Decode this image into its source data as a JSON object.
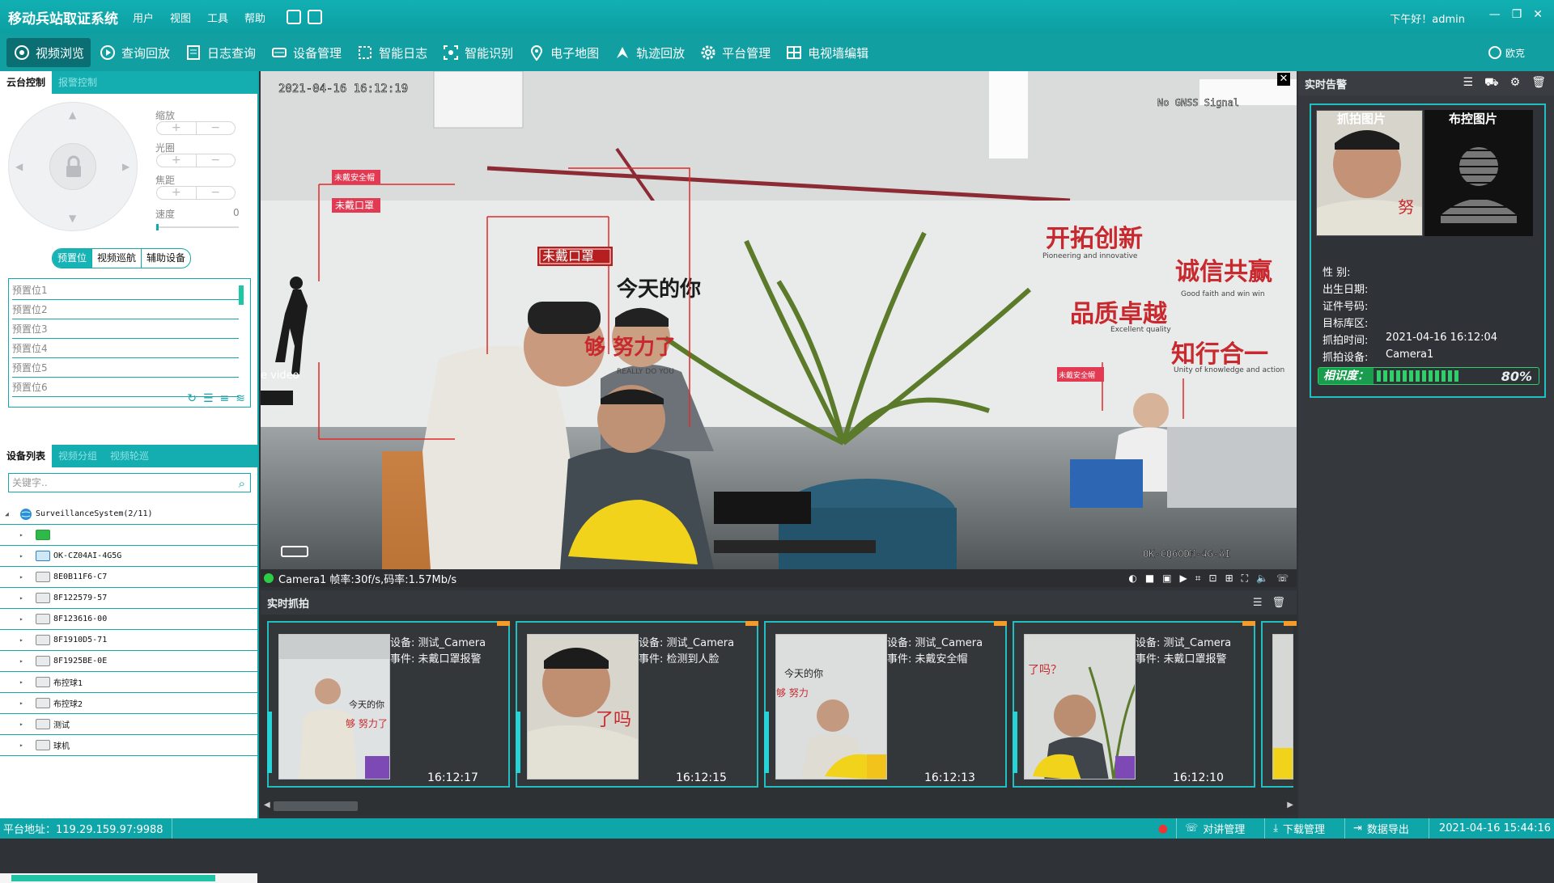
{
  "app": {
    "title": "移动兵站取证系统",
    "menu": [
      "用户",
      "视图",
      "工具",
      "帮助"
    ],
    "greeting": "下午好！admin"
  },
  "toolbar": {
    "items": [
      "视频浏览",
      "查询回放",
      "日志查询",
      "设备管理",
      "智能日志",
      "智能识别",
      "电子地图",
      "轨迹回放",
      "平台管理",
      "电视墙编辑"
    ],
    "active": 0,
    "logo": "欧克"
  },
  "left": {
    "top_tabs": [
      "云台控制",
      "报警控制"
    ],
    "controls": {
      "zoom": "缩放",
      "iris": "光圈",
      "focus": "焦距",
      "speed": "速度",
      "speed_value": "0"
    },
    "preset_tabs": [
      "预置位",
      "视频巡航",
      "辅助设备"
    ],
    "presets": [
      "预置位1",
      "预置位2",
      "预置位3",
      "预置位4",
      "预置位5",
      "预置位6"
    ],
    "device_tabs": [
      "设备列表",
      "视频分组",
      "视频轮巡"
    ],
    "search_placeholder": "关键字..",
    "tree": {
      "root": "SurveillanceSystem(2/11)",
      "nodes": [
        "",
        "OK-CZ04AI-4G5G",
        "8E0B11F6-C7",
        "8F122579-57",
        "8F123616-00",
        "8F1910D5-71",
        "8F1925BE-0E",
        "布控球1",
        "布控球2",
        "测试",
        "球机"
      ]
    }
  },
  "video": {
    "timestamp": "2021-04-16 16:12:19",
    "gnss": "No GNSS Signal",
    "watermark": "OK-CQ60DM-4G-AI",
    "labels": [
      "未戴安全帽",
      "未戴口罩",
      "未戴口罩",
      "未戴安全帽"
    ],
    "status": "Camera1  帧率:30f/s,码率:1.57Mb/s",
    "wall_text": [
      "开拓创新",
      "诚信共赢",
      "品质卓越",
      "知行合一",
      "今天的你",
      "够 努力了",
      "Good faith and win win",
      "Excellent quality",
      "Unity of knowledge and action",
      "Pioneering and innovative",
      "REALLY DO YOU",
      "e video"
    ]
  },
  "capture": {
    "title": "实时抓拍",
    "device_label": "设备:",
    "event_label": "事件:",
    "items": [
      {
        "device": "测试_Camera",
        "event": "未戴口罩报警",
        "time": "16:12:17"
      },
      {
        "device": "测试_Camera",
        "event": "检测到人脸",
        "time": "16:12:15"
      },
      {
        "device": "测试_Camera",
        "event": "未戴安全帽",
        "time": "16:12:13"
      },
      {
        "device": "测试_Camera",
        "event": "未戴口罩报警",
        "time": "16:12:10"
      }
    ]
  },
  "alarm": {
    "title": "实时告警",
    "snap_label": "抓拍图片",
    "control_label": "布控图片",
    "fields": [
      {
        "label": "性    别:",
        "value": ""
      },
      {
        "label": "出生日期:",
        "value": ""
      },
      {
        "label": "证件号码:",
        "value": ""
      },
      {
        "label": "目标库区:",
        "value": ""
      },
      {
        "label": "抓拍时间:",
        "value": "2021-04-16 16:12:04"
      },
      {
        "label": "抓拍设备:",
        "value": "Camera1"
      }
    ],
    "similarity_label": "相识度：",
    "similarity": "80%",
    "similarity_value": 0.8
  },
  "status": {
    "server": "平台地址：119.29.159.97:9988",
    "intercom": "对讲管理",
    "download": "下载管理",
    "export": "数据导出",
    "datetime": "2021-04-16 15:44:16"
  },
  "colors": {
    "accent": "#12aaad",
    "alert_red": "#e02a2a",
    "similarity_green": "#2ed06a"
  }
}
